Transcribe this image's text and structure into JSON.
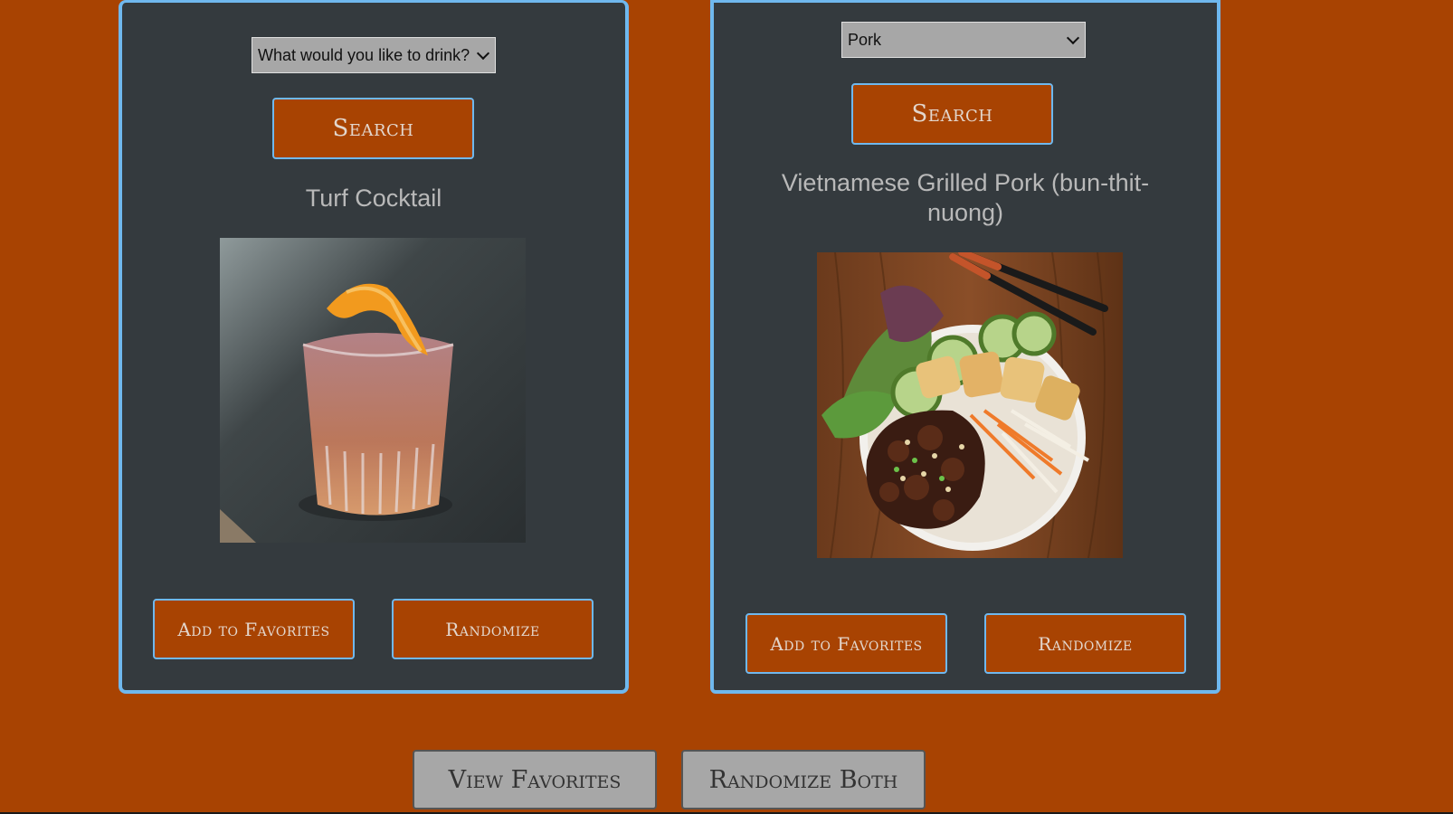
{
  "drink": {
    "select_value": "What would you like to drink?",
    "search_label": "Search",
    "title": "Turf Cocktail",
    "add_favorites_label": "Add to Favorites",
    "randomize_label": "Randomize"
  },
  "food": {
    "select_value": "Pork",
    "search_label": "Search",
    "title": "Vietnamese Grilled Pork (bun-thit-nuong)",
    "add_favorites_label": "Add to Favorites",
    "randomize_label": "Randomize"
  },
  "footer": {
    "view_favorites_label": "View Favorites",
    "randomize_both_label": "Randomize Both"
  },
  "colors": {
    "page_background": "#a84302",
    "card_background": "#343a3e",
    "card_border": "#6fb8ee",
    "button_text": "#e3d6cc"
  }
}
